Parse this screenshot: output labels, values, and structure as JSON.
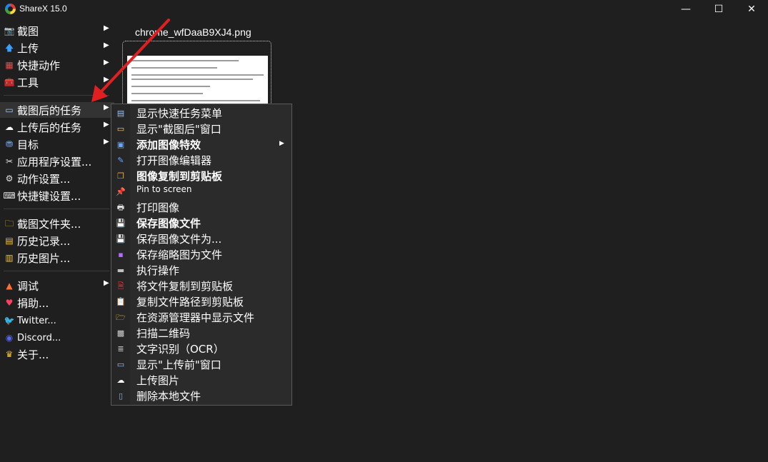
{
  "window": {
    "title": "ShareX 15.0",
    "minimize_glyph": "—",
    "maximize_glyph": "☐",
    "close_glyph": "✕"
  },
  "main_menu": {
    "items": [
      {
        "label": "截图",
        "icon": "camera-icon",
        "glyph": "📷",
        "has_submenu": true
      },
      {
        "label": "上传",
        "icon": "upload-arrow-icon",
        "glyph": "🡅",
        "has_submenu": true
      },
      {
        "label": "快捷动作",
        "icon": "grid-icon",
        "glyph": "▦",
        "has_submenu": true
      },
      {
        "label": "工具",
        "icon": "toolbox-icon",
        "glyph": "🧰",
        "has_submenu": true
      },
      {
        "label": "截图后的任务",
        "icon": "screen-icon",
        "glyph": "▭",
        "has_submenu": true
      },
      {
        "label": "上传后的任务",
        "icon": "cloud-icon",
        "glyph": "☁",
        "has_submenu": true
      },
      {
        "label": "目标",
        "icon": "target-icon",
        "glyph": "⛃",
        "has_submenu": true
      },
      {
        "label": "应用程序设置...",
        "icon": "tools-icon",
        "glyph": "✂",
        "has_submenu": false
      },
      {
        "label": "动作设置...",
        "icon": "gear-icon",
        "glyph": "⚙",
        "has_submenu": false
      },
      {
        "label": "快捷键设置...",
        "icon": "keyboard-icon",
        "glyph": "⌨",
        "has_submenu": false
      },
      {
        "label": "截图文件夹...",
        "icon": "folder-icon",
        "glyph": "🗀",
        "has_submenu": false
      },
      {
        "label": "历史记录...",
        "icon": "history-icon",
        "glyph": "▤",
        "has_submenu": false
      },
      {
        "label": "历史图片...",
        "icon": "images-icon",
        "glyph": "▥",
        "has_submenu": false
      },
      {
        "label": "调试",
        "icon": "cone-icon",
        "glyph": "▲",
        "has_submenu": true
      },
      {
        "label": "捐助...",
        "icon": "heart-icon",
        "glyph": "♥",
        "has_submenu": false
      },
      {
        "label": "Twitter...",
        "icon": "twitter-icon",
        "glyph": "🐦",
        "has_submenu": false
      },
      {
        "label": "Discord...",
        "icon": "discord-icon",
        "glyph": "◉",
        "has_submenu": false
      },
      {
        "label": "关于...",
        "icon": "crown-icon",
        "glyph": "♛",
        "has_submenu": false
      }
    ]
  },
  "thumbnail": {
    "filename": "chrome_wfDaaB9XJ4.png"
  },
  "submenu": {
    "items": [
      {
        "label": "显示快速任务菜单",
        "icon": "quick-task-menu-icon",
        "glyph": "▤",
        "bold": false,
        "has_submenu": false
      },
      {
        "label": "显示\"截图后\"窗口",
        "icon": "window-icon",
        "glyph": "▭",
        "bold": false,
        "has_submenu": false
      },
      {
        "label": "添加图像特效",
        "icon": "image-effects-icon",
        "glyph": "▣",
        "bold": true,
        "has_submenu": true
      },
      {
        "label": "打开图像编辑器",
        "icon": "image-editor-icon",
        "glyph": "✎",
        "bold": false,
        "has_submenu": false
      },
      {
        "label": "图像复制到剪贴板",
        "icon": "copy-image-icon",
        "glyph": "❐",
        "bold": true,
        "has_submenu": false
      },
      {
        "label": "Pin to screen",
        "icon": "pin-icon",
        "glyph": "📌",
        "bold": false,
        "has_submenu": false
      },
      {
        "label": "打印图像",
        "icon": "printer-icon",
        "glyph": "🖶",
        "bold": false,
        "has_submenu": false
      },
      {
        "label": "保存图像文件",
        "icon": "save-icon",
        "glyph": "💾",
        "bold": true,
        "has_submenu": false
      },
      {
        "label": "保存图像文件为...",
        "icon": "save-as-icon",
        "glyph": "💾",
        "bold": false,
        "has_submenu": false
      },
      {
        "label": "保存缩略图为文件",
        "icon": "save-thumbnail-icon",
        "glyph": "▪",
        "bold": false,
        "has_submenu": false
      },
      {
        "label": "执行操作",
        "icon": "terminal-icon",
        "glyph": "▬",
        "bold": false,
        "has_submenu": false
      },
      {
        "label": "将文件复制到剪贴板",
        "icon": "copy-file-icon",
        "glyph": "🗎",
        "bold": false,
        "has_submenu": false
      },
      {
        "label": "复制文件路径到剪贴板",
        "icon": "clipboard-icon",
        "glyph": "📋",
        "bold": false,
        "has_submenu": false
      },
      {
        "label": "在资源管理器中显示文件",
        "icon": "explorer-folder-icon",
        "glyph": "🗁",
        "bold": false,
        "has_submenu": false
      },
      {
        "label": "扫描二维码",
        "icon": "qr-code-icon",
        "glyph": "▩",
        "bold": false,
        "has_submenu": false
      },
      {
        "label": "文字识别（OCR）",
        "icon": "ocr-icon",
        "glyph": "≣",
        "bold": false,
        "has_submenu": false
      },
      {
        "label": "显示\"上传前\"窗口",
        "icon": "before-upload-window-icon",
        "glyph": "▭",
        "bold": false,
        "has_submenu": false
      },
      {
        "label": "上传图片",
        "icon": "cloud-upload-icon",
        "glyph": "☁",
        "bold": false,
        "has_submenu": false
      },
      {
        "label": "删除本地文件",
        "icon": "delete-file-icon",
        "glyph": "▯",
        "bold": false,
        "has_submenu": false
      }
    ]
  },
  "colors": {
    "background": "#1f1f1f",
    "menu_bg": "#2b2b2b",
    "highlight": "#333333",
    "annotation_arrow": "#e02020"
  }
}
